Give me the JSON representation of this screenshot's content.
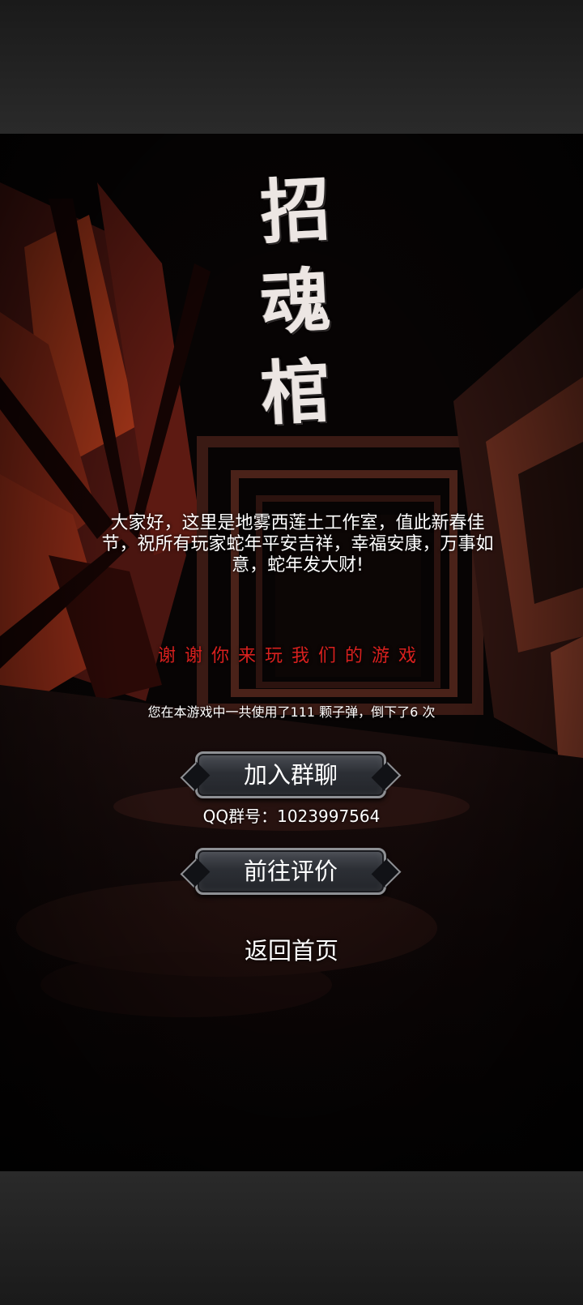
{
  "game": {
    "title_chars": [
      "招",
      "魂",
      "棺"
    ]
  },
  "message": {
    "greeting": "大家好，这里是地雾西莲土工作室，值此新春佳节，祝所有玩家蛇年平安吉祥，幸福安康，万事如意，蛇年发大财!",
    "thanks": "谢谢你来玩我们的游戏",
    "stats": "您在本游戏中一共使用了111 颗子弹，倒下了6 次"
  },
  "stats": {
    "bullets_used": 111,
    "times_fallen": 6
  },
  "buttons": {
    "join_group": "加入群聊",
    "qq_group": "QQ群号：1023997564",
    "rate": "前往评价",
    "home": "返回首页"
  },
  "colors": {
    "accent_red": "#d8201e",
    "button_border": "#8e9094",
    "text": "#ffffff"
  }
}
